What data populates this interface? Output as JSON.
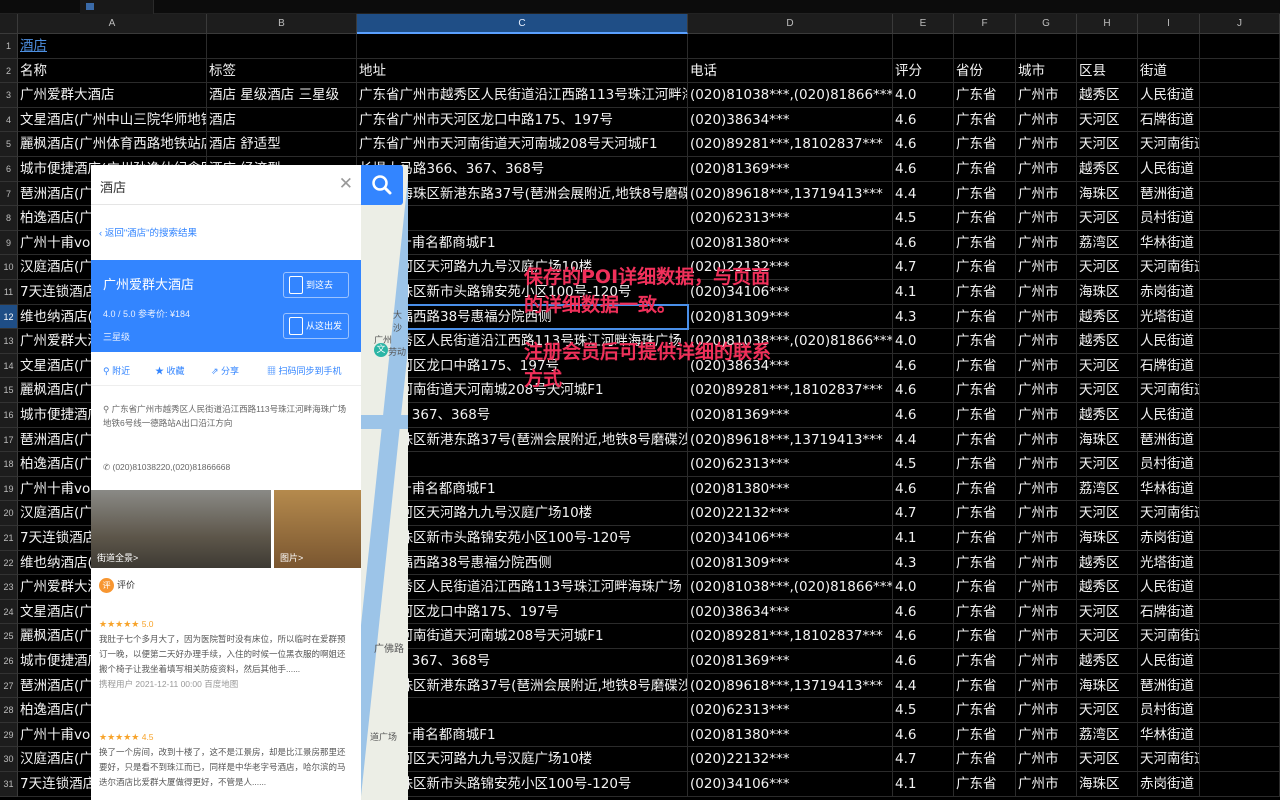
{
  "columns": [
    "A",
    "B",
    "C",
    "D",
    "E",
    "F",
    "G",
    "H",
    "I",
    "J"
  ],
  "selected_column": "C",
  "selected_row": "12",
  "rows": [
    {
      "num": "1",
      "cells": [
        "酒店",
        "",
        "",
        "",
        "",
        "",
        "",
        "",
        ""
      ]
    },
    {
      "num": "2",
      "cells": [
        "名称",
        "标签",
        "地址",
        "电话",
        "评分",
        "省份",
        "城市",
        "区县",
        "街道"
      ]
    },
    {
      "num": "3",
      "cells": [
        "广州爱群大酒店",
        "酒店 星级酒店 三星级",
        "广东省广州市越秀区人民街道沿江西路113号珠江河畔海珠广场",
        "(020)81038***,(020)81866***",
        "4.0",
        "广东省",
        "广州市",
        "越秀区",
        "人民街道"
      ]
    },
    {
      "num": "4",
      "cells": [
        "文星酒店(广州中山三院华师地铁站店",
        "酒店",
        "广东省广州市天河区龙口中路175、197号",
        "(020)38634***",
        "4.6",
        "广东省",
        "广州市",
        "天河区",
        "石牌街道"
      ]
    },
    {
      "num": "5",
      "cells": [
        "麗枫酒店(广州体育西路地铁站店",
        "酒店 舒适型",
        "广东省广州市天河南街道天河南城208号天河城F1",
        "(020)89281***,18102837***",
        "4.6",
        "广东省",
        "广州市",
        "天河区",
        "天河南街道"
      ]
    },
    {
      "num": "6",
      "cells": [
        "城市便捷酒店(广州孙逸仙纪念医院店",
        "酒店 经济型",
        "长堤大马路366、367、368号",
        "(020)81369***",
        "4.6",
        "广东省",
        "广州市",
        "越秀区",
        "人民街道"
      ]
    },
    {
      "num": "7",
      "cells": [
        "琶洲酒店(广",
        "",
        "广州市海珠区新港东路37号(琶洲会展附近,地铁8号磨碟沙",
        "(020)89618***,13719413***",
        "4.4",
        "广东省",
        "广州市",
        "海珠区",
        "琶洲街道"
      ]
    },
    {
      "num": "8",
      "cells": [
        "柏逸酒店(广",
        "",
        "13号",
        "(020)62313***",
        "4.5",
        "广东省",
        "广州市",
        "天河区",
        "员村街道"
      ]
    },
    {
      "num": "9",
      "cells": [
        "广州十甫voc",
        "",
        "186号十甫名都商城F1",
        "(020)81380***",
        "4.6",
        "广东省",
        "广州市",
        "荔湾区",
        "华林街道"
      ]
    },
    {
      "num": "10",
      "cells": [
        "汉庭酒店(广",
        "",
        "州市天河区天河路九九号汉庭广场10楼",
        "(020)22132***",
        "4.7",
        "广东省",
        "广州市",
        "天河区",
        "天河南街道"
      ]
    },
    {
      "num": "11",
      "cells": [
        "7天连锁酒店",
        "",
        "州市海珠区新市头路锦安苑小区100号-120号",
        "(020)34106***",
        "4.1",
        "广东省",
        "广州市",
        "海珠区",
        "赤岗街道"
      ]
    },
    {
      "num": "12",
      "cells": [
        "维也纳酒店(",
        "",
        "秀区惠福西路38号惠福分院西侧",
        "(020)81309***",
        "4.3",
        "广东省",
        "广州市",
        "越秀区",
        "光塔街道"
      ]
    },
    {
      "num": "13",
      "cells": [
        "广州爱群大酒",
        "",
        "州市越秀区人民街道沿江西路113号珠江河畔海珠广场",
        "(020)81038***,(020)81866***",
        "4.0",
        "广东省",
        "广州市",
        "越秀区",
        "人民街道"
      ]
    },
    {
      "num": "14",
      "cells": [
        "文星酒店(广",
        "",
        "州市天河区龙口中路175、197号",
        "(020)38634***",
        "4.6",
        "广东省",
        "广州市",
        "天河区",
        "石牌街道"
      ]
    },
    {
      "num": "15",
      "cells": [
        "麗枫酒店(广",
        "",
        "州市天河南街道天河南城208号天河城F1",
        "(020)89281***,18102837***",
        "4.6",
        "广东省",
        "广州市",
        "天河区",
        "天河南街道"
      ]
    },
    {
      "num": "16",
      "cells": [
        "城市便捷酒店",
        "",
        "路366、367、368号",
        "(020)81369***",
        "4.6",
        "广东省",
        "广州市",
        "越秀区",
        "人民街道"
      ]
    },
    {
      "num": "17",
      "cells": [
        "琶洲酒店(广",
        "",
        "州市海珠区新港东路37号(琶洲会展附近,地铁8号磨碟沙",
        "(020)89618***,13719413***",
        "4.4",
        "广东省",
        "广州市",
        "海珠区",
        "琶洲街道"
      ]
    },
    {
      "num": "18",
      "cells": [
        "柏逸酒店(广",
        "",
        "13号",
        "(020)62313***",
        "4.5",
        "广东省",
        "广州市",
        "天河区",
        "员村街道"
      ]
    },
    {
      "num": "19",
      "cells": [
        "广州十甫voc",
        "",
        "186号十甫名都商城F1",
        "(020)81380***",
        "4.6",
        "广东省",
        "广州市",
        "荔湾区",
        "华林街道"
      ]
    },
    {
      "num": "20",
      "cells": [
        "汉庭酒店(广",
        "",
        "州市天河区天河路九九号汉庭广场10楼",
        "(020)22132***",
        "4.7",
        "广东省",
        "广州市",
        "天河区",
        "天河南街道"
      ]
    },
    {
      "num": "21",
      "cells": [
        "7天连锁酒店",
        "",
        "州市海珠区新市头路锦安苑小区100号-120号",
        "(020)34106***",
        "4.1",
        "广东省",
        "广州市",
        "海珠区",
        "赤岗街道"
      ]
    },
    {
      "num": "22",
      "cells": [
        "维也纳酒店(",
        "",
        "秀区惠福西路38号惠福分院西侧",
        "(020)81309***",
        "4.3",
        "广东省",
        "广州市",
        "越秀区",
        "光塔街道"
      ]
    },
    {
      "num": "23",
      "cells": [
        "广州爱群大酒",
        "",
        "州市越秀区人民街道沿江西路113号珠江河畔海珠广场",
        "(020)81038***,(020)81866***",
        "4.0",
        "广东省",
        "广州市",
        "越秀区",
        "人民街道"
      ]
    },
    {
      "num": "24",
      "cells": [
        "文星酒店(广",
        "",
        "州市天河区龙口中路175、197号",
        "(020)38634***",
        "4.6",
        "广东省",
        "广州市",
        "天河区",
        "石牌街道"
      ]
    },
    {
      "num": "25",
      "cells": [
        "麗枫酒店(广",
        "",
        "州市天河南街道天河南城208号天河城F1",
        "(020)89281***,18102837***",
        "4.6",
        "广东省",
        "广州市",
        "天河区",
        "天河南街道"
      ]
    },
    {
      "num": "26",
      "cells": [
        "城市便捷酒店",
        "",
        "路366、367、368号",
        "(020)81369***",
        "4.6",
        "广东省",
        "广州市",
        "越秀区",
        "人民街道"
      ]
    },
    {
      "num": "27",
      "cells": [
        "琶洲酒店(广",
        "",
        "州市海珠区新港东路37号(琶洲会展附近,地铁8号磨碟沙",
        "(020)89618***,13719413***",
        "4.4",
        "广东省",
        "广州市",
        "海珠区",
        "琶洲街道"
      ]
    },
    {
      "num": "28",
      "cells": [
        "柏逸酒店(广",
        "",
        "13号",
        "(020)62313***",
        "4.5",
        "广东省",
        "广州市",
        "天河区",
        "员村街道"
      ]
    },
    {
      "num": "29",
      "cells": [
        "广州十甫voc",
        "",
        "186号十甫名都商城F1",
        "(020)81380***",
        "4.6",
        "广东省",
        "广州市",
        "荔湾区",
        "华林街道"
      ]
    },
    {
      "num": "30",
      "cells": [
        "汉庭酒店(广",
        "",
        "州市天河区天河路九九号汉庭广场10楼",
        "(020)22132***",
        "4.7",
        "广东省",
        "广州市",
        "天河区",
        "天河南街道"
      ]
    },
    {
      "num": "31",
      "cells": [
        "7天连锁酒店",
        "",
        "州市海珠区新市头路锦安苑小区100号-120号",
        "(020)34106***",
        "4.1",
        "广东省",
        "广州市",
        "海珠区",
        "赤岗街道"
      ]
    }
  ],
  "map_panel": {
    "search_query": "酒店",
    "back_link": "返回\"酒店\"的搜索结果",
    "hotel_name": "广州爱群大酒店",
    "score_line": "4.0 / 5.0    参考价: ¥184",
    "star_level": "三星级",
    "go_here": "到这去",
    "depart_here": "从这出发",
    "actions": [
      "附近",
      "收藏",
      "分享",
      "扫码同步到手机"
    ],
    "address": "广东省广州市越秀区人民街道沿江西路113号珠江河畔海珠广场地铁6号线一德路站A出口沿江方向",
    "phone": "(020)81038220,(020)81866668",
    "photo_street": "街道全景>",
    "photo_pics": "图片>",
    "review_header": "评价",
    "review_badge": "评",
    "reviews": [
      {
        "stars": "★★★★★",
        "score": "5.0",
        "text": "我肚子七个多月大了，因为医院暂时没有床位，所以临时在爱群预订一晚，以便第二天好办理手续，入住的时候一位黑衣服的啊姐还搬个椅子让我坐着填写相关防疫资料，然后其他手......",
        "meta": "携程用户    2021-12-11 00:00    百度地图"
      },
      {
        "stars": "★★★★★",
        "score": "4.5",
        "text": "换了一个房间，改到十楼了，这不是江景房，却是比江景房那里还要好，只是看不到珠江而已，同样是中华老字号酒店，哈尔滨的马迭尔酒店比爱群大厦做得更好，不管是人......",
        "meta": ""
      }
    ],
    "map_labels": [
      "广州",
      "文",
      "劳动",
      "广佛路",
      "道广场",
      "大沙"
    ]
  },
  "annotation": {
    "line1": "保存的POI详细数据，与页面",
    "line2": "的详细数据一致。",
    "line3": "注册会员后可提供详细的联系",
    "line4": "方式"
  },
  "colors": {
    "accent": "#3385ff",
    "annotation": "#f0305a",
    "selection": "#4a8fe8"
  }
}
